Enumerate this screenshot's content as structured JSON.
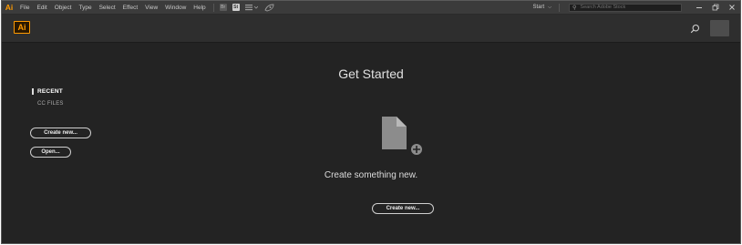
{
  "app": {
    "logo": "Ai",
    "badge": "Ai"
  },
  "menubar": {
    "items": [
      "File",
      "Edit",
      "Object",
      "Type",
      "Select",
      "Effect",
      "View",
      "Window",
      "Help"
    ],
    "br_icon": "Br",
    "st_icon": "St",
    "workspace": "Start",
    "search_placeholder": "Search Adobe Stock"
  },
  "sidebar": {
    "recent_label": "RECENT",
    "cc_files_label": "CC FILES",
    "create_new_label": "Create new...",
    "open_label": "Open..."
  },
  "main": {
    "title": "Get Started",
    "subtitle": "Create something new.",
    "create_new_label": "Create new..."
  },
  "icons": {
    "app_logo": "illustrator-logo-icon",
    "search": "search-icon",
    "new_document": "new-document-icon"
  },
  "colors": {
    "accent": "#FF9A00",
    "background": "#232323",
    "menubar": "#3B3B3B",
    "appbar": "#2E2E2E"
  }
}
